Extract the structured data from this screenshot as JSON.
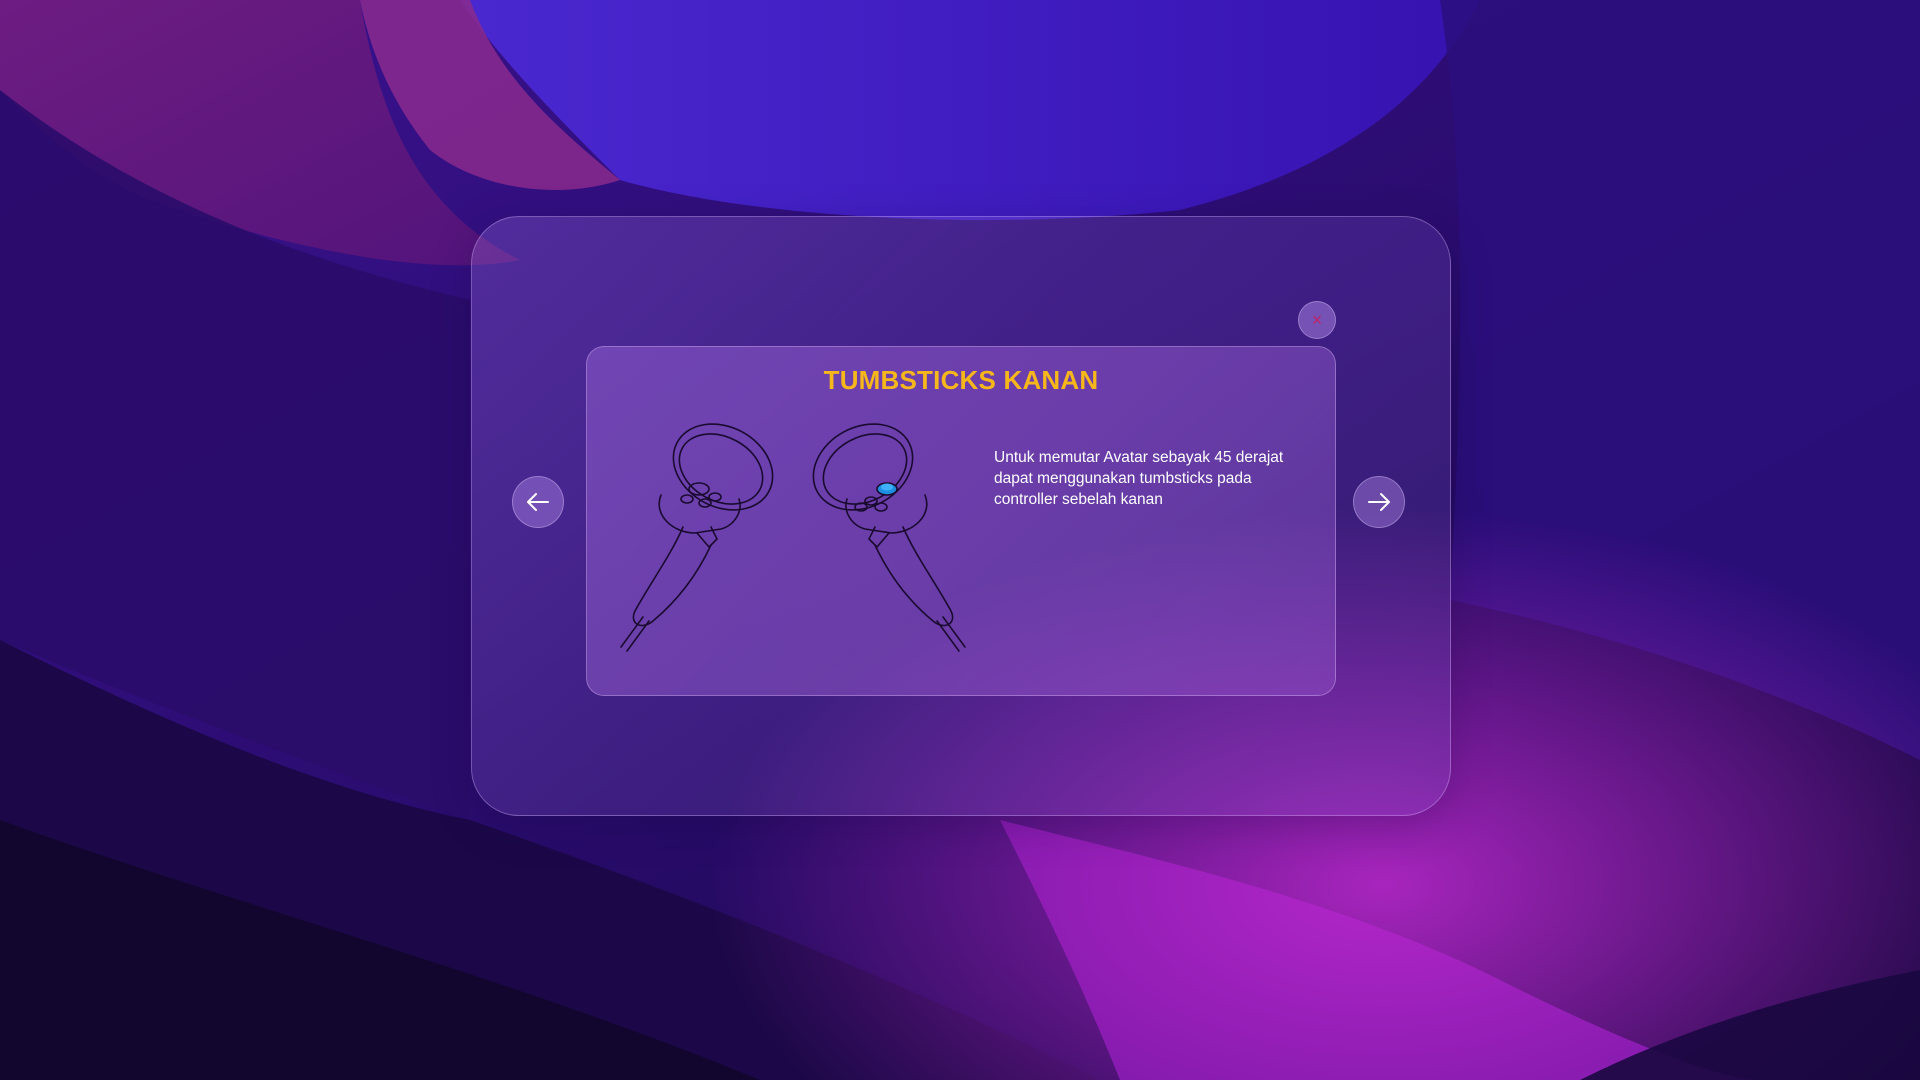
{
  "dialog": {
    "title": "TUMBSTICKS KANAN",
    "description_lines": [
      "Untuk memutar Avatar sebayak 45 derajat",
      "dapat menggunakan tumbsticks pada",
      "controller sebelah kanan"
    ],
    "close_icon": "close-icon",
    "close_glyph": "×",
    "prev_icon": "arrow-left-icon",
    "next_icon": "arrow-right-icon",
    "illustration_icon": "vr-controllers-icon"
  },
  "colors": {
    "title": "#f6b71a",
    "close": "#c0246a",
    "highlight_thumbstick": "#1e8fe0"
  }
}
